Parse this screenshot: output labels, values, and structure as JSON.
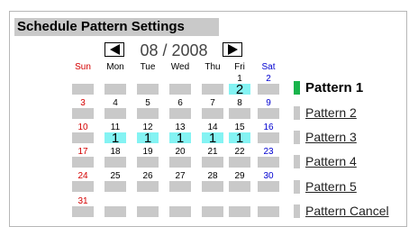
{
  "title": "Schedule Pattern Settings",
  "nav": {
    "prev_icon": "arrow-left-icon",
    "next_icon": "arrow-right-icon",
    "month_label": "08 / 2008"
  },
  "weekdays": [
    "Sun",
    "Mon",
    "Tue",
    "Wed",
    "Thu",
    "Fri",
    "Sat"
  ],
  "weeks": [
    [
      {
        "d": "",
        "p": ""
      },
      {
        "d": "",
        "p": ""
      },
      {
        "d": "",
        "p": ""
      },
      {
        "d": "",
        "p": ""
      },
      {
        "d": "",
        "p": ""
      },
      {
        "d": "1",
        "p": "2"
      },
      {
        "d": "2",
        "p": ""
      }
    ],
    [
      {
        "d": "3",
        "p": ""
      },
      {
        "d": "4",
        "p": ""
      },
      {
        "d": "5",
        "p": ""
      },
      {
        "d": "6",
        "p": ""
      },
      {
        "d": "7",
        "p": ""
      },
      {
        "d": "8",
        "p": ""
      },
      {
        "d": "9",
        "p": ""
      }
    ],
    [
      {
        "d": "10",
        "p": ""
      },
      {
        "d": "11",
        "p": "1"
      },
      {
        "d": "12",
        "p": "1"
      },
      {
        "d": "13",
        "p": "1"
      },
      {
        "d": "14",
        "p": "1"
      },
      {
        "d": "15",
        "p": "1"
      },
      {
        "d": "16",
        "p": ""
      }
    ],
    [
      {
        "d": "17",
        "p": ""
      },
      {
        "d": "18",
        "p": ""
      },
      {
        "d": "19",
        "p": ""
      },
      {
        "d": "20",
        "p": ""
      },
      {
        "d": "21",
        "p": ""
      },
      {
        "d": "22",
        "p": ""
      },
      {
        "d": "23",
        "p": ""
      }
    ],
    [
      {
        "d": "24",
        "p": ""
      },
      {
        "d": "25",
        "p": ""
      },
      {
        "d": "26",
        "p": ""
      },
      {
        "d": "27",
        "p": ""
      },
      {
        "d": "28",
        "p": ""
      },
      {
        "d": "29",
        "p": ""
      },
      {
        "d": "30",
        "p": ""
      }
    ],
    [
      {
        "d": "31",
        "p": ""
      },
      {
        "d": "",
        "p": ""
      },
      {
        "d": "",
        "p": ""
      },
      {
        "d": "",
        "p": ""
      },
      {
        "d": "",
        "p": ""
      },
      {
        "d": "",
        "p": ""
      },
      {
        "d": "",
        "p": ""
      }
    ]
  ],
  "patterns": [
    {
      "label": "Pattern 1",
      "active": true
    },
    {
      "label": "Pattern 2",
      "active": false
    },
    {
      "label": "Pattern 3",
      "active": false
    },
    {
      "label": "Pattern 4",
      "active": false
    },
    {
      "label": "Pattern 5",
      "active": false
    },
    {
      "label": "Pattern Cancel",
      "active": false
    }
  ],
  "colors": {
    "cell_gray": "#c9c9c9",
    "cell_assigned": "#84f3f3",
    "sunday": "#d40000",
    "saturday": "#0000d0",
    "active_pattern": "#19b44c"
  }
}
